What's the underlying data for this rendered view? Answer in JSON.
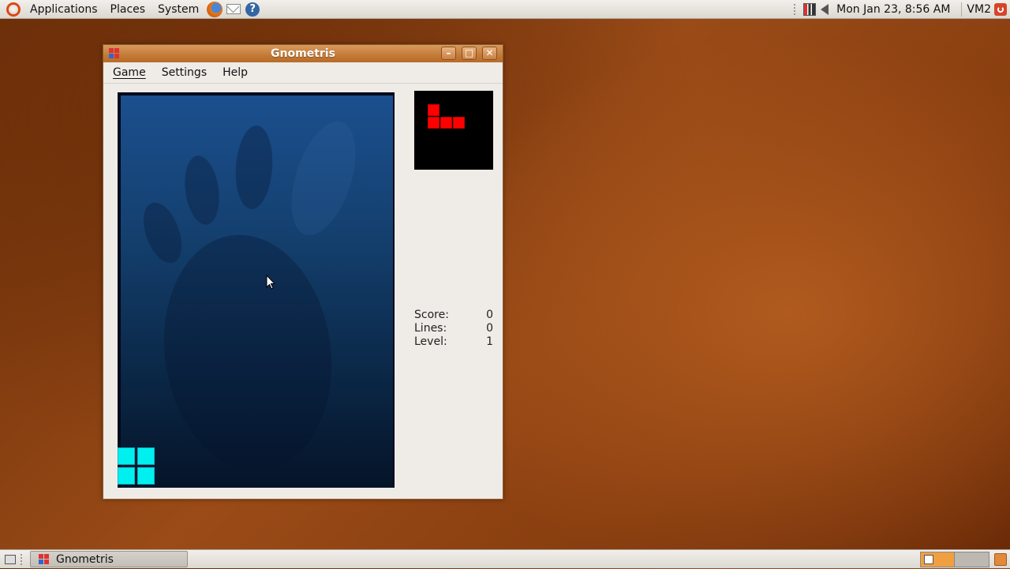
{
  "top_panel": {
    "menus": [
      "Applications",
      "Places",
      "System"
    ],
    "launchers": [
      "firefox-icon",
      "mail-icon",
      "help-icon"
    ],
    "help_glyph": "?",
    "clock": "Mon Jan 23,  8:56 AM",
    "user": "VM2"
  },
  "window": {
    "title": "Gnometris",
    "buttons": {
      "minimize": "–",
      "maximize": "□",
      "close": "✕"
    },
    "menus": [
      "Game",
      "Settings",
      "Help"
    ],
    "stats": [
      {
        "label": "Score:",
        "value": "0"
      },
      {
        "label": "Lines:",
        "value": "0"
      },
      {
        "label": "Level:",
        "value": "1"
      }
    ],
    "colors": {
      "current_piece": "#00f0f0",
      "next_piece": "#ff0000"
    }
  },
  "bottom_panel": {
    "task": {
      "label": "Gnometris"
    }
  }
}
